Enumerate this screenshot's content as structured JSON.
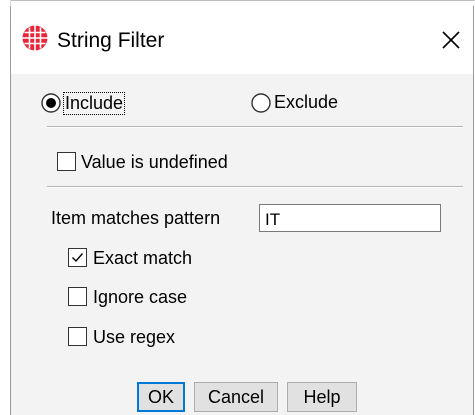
{
  "dialog": {
    "title": "String Filter",
    "icon": "grid-globe-icon",
    "close_icon": "close-icon"
  },
  "mode": {
    "include_label": "Include",
    "exclude_label": "Exclude",
    "selected": "Include"
  },
  "undefined_option": {
    "label": "Value is undefined",
    "checked": false
  },
  "pattern": {
    "label": "Item matches pattern",
    "value": "IT",
    "options": [
      {
        "label": "Exact match",
        "checked": true
      },
      {
        "label": "Ignore case",
        "checked": false
      },
      {
        "label": "Use regex",
        "checked": false
      }
    ]
  },
  "buttons": {
    "ok": "OK",
    "cancel": "Cancel",
    "help": "Help"
  },
  "colors": {
    "accent": "#0078d7",
    "icon_red": "#e8263a",
    "dialog_bg": "#f3f3f3"
  }
}
